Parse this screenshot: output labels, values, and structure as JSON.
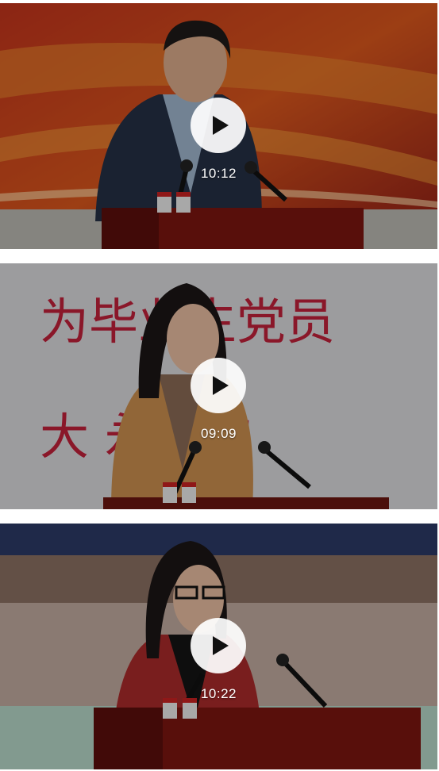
{
  "videos": [
    {
      "duration": "10:12",
      "play_icon": "play-icon"
    },
    {
      "duration": "09:09",
      "play_icon": "play-icon",
      "backdrop_text_line1": "为毕业生党员",
      "backdrop_text_line2": "大   永远的"
    },
    {
      "duration": "10:22",
      "play_icon": "play-icon"
    }
  ],
  "colors": {
    "play_circle": "#ffffff",
    "play_glyph": "#111111",
    "duration_text": "#ffffff"
  }
}
